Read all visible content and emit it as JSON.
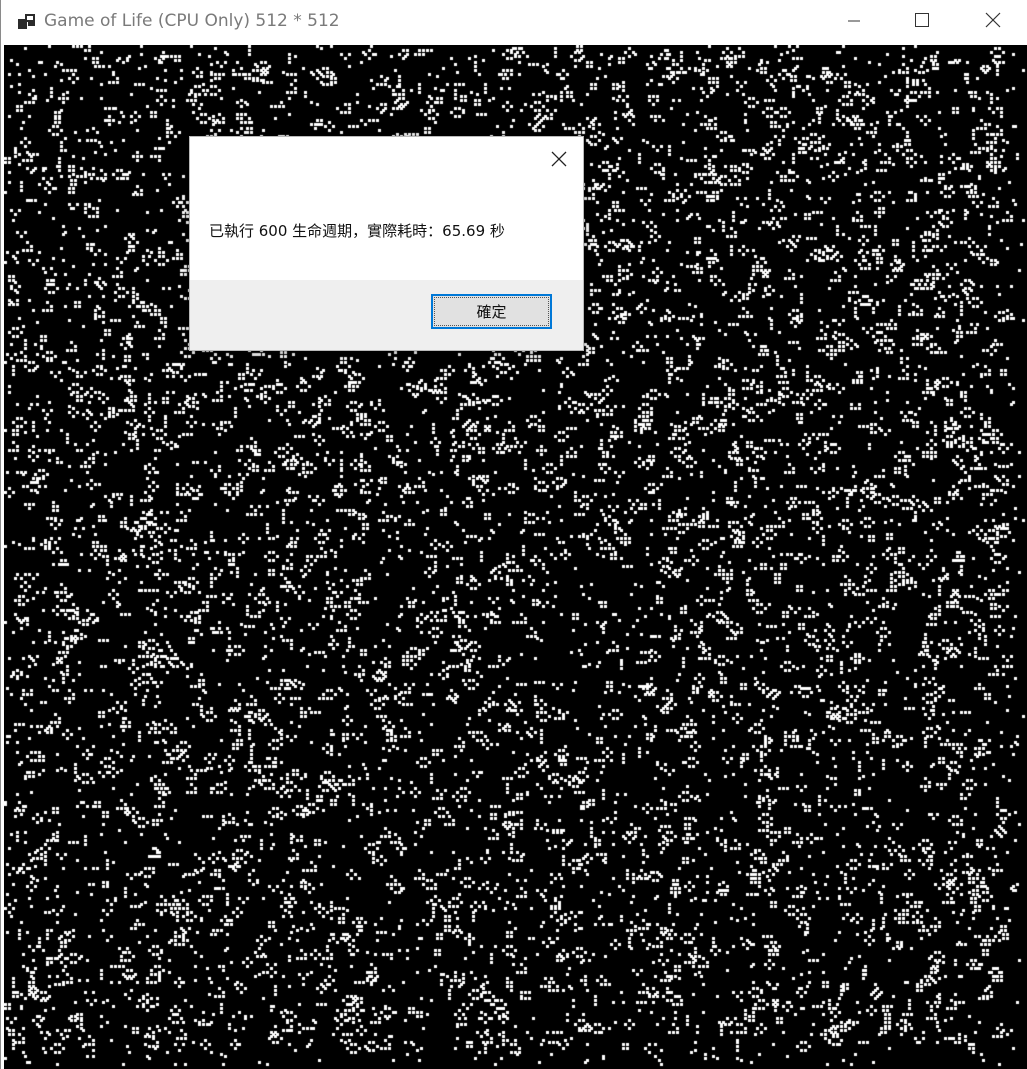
{
  "window": {
    "title": "Game of Life (CPU Only) 512 * 512",
    "icon": "app-window-icon",
    "controls": {
      "minimize_icon": "minimize-icon",
      "maximize_icon": "maximize-icon",
      "close_icon": "close-icon"
    }
  },
  "canvas": {
    "grid_cells": "512 * 512",
    "background": "#000000",
    "cell_color": "#ffffff"
  },
  "dialog": {
    "message": "已執行 600 生命週期，實際耗時：65.69 秒",
    "ok_label": "確定",
    "close_icon": "close-icon"
  },
  "colors": {
    "accent": "#0078d7",
    "dialog_footer": "#efefef"
  }
}
